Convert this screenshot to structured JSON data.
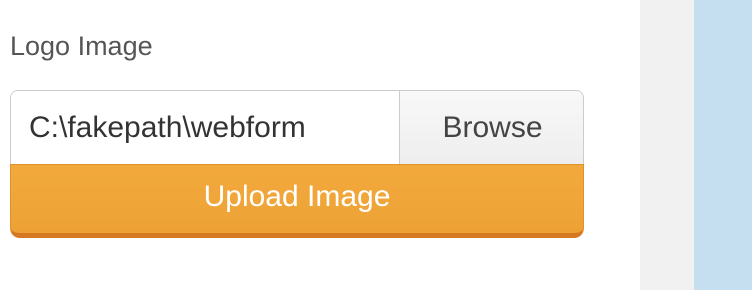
{
  "form": {
    "logo_label": "Logo Image",
    "file_path_value": "C:\\fakepath\\webform",
    "browse_label": "Browse",
    "upload_label": "Upload Image"
  },
  "colors": {
    "upload_button": "#eea236",
    "upload_border": "#d4791f",
    "side_grey": "#f1f1f1",
    "side_blue": "#c5dff1"
  }
}
